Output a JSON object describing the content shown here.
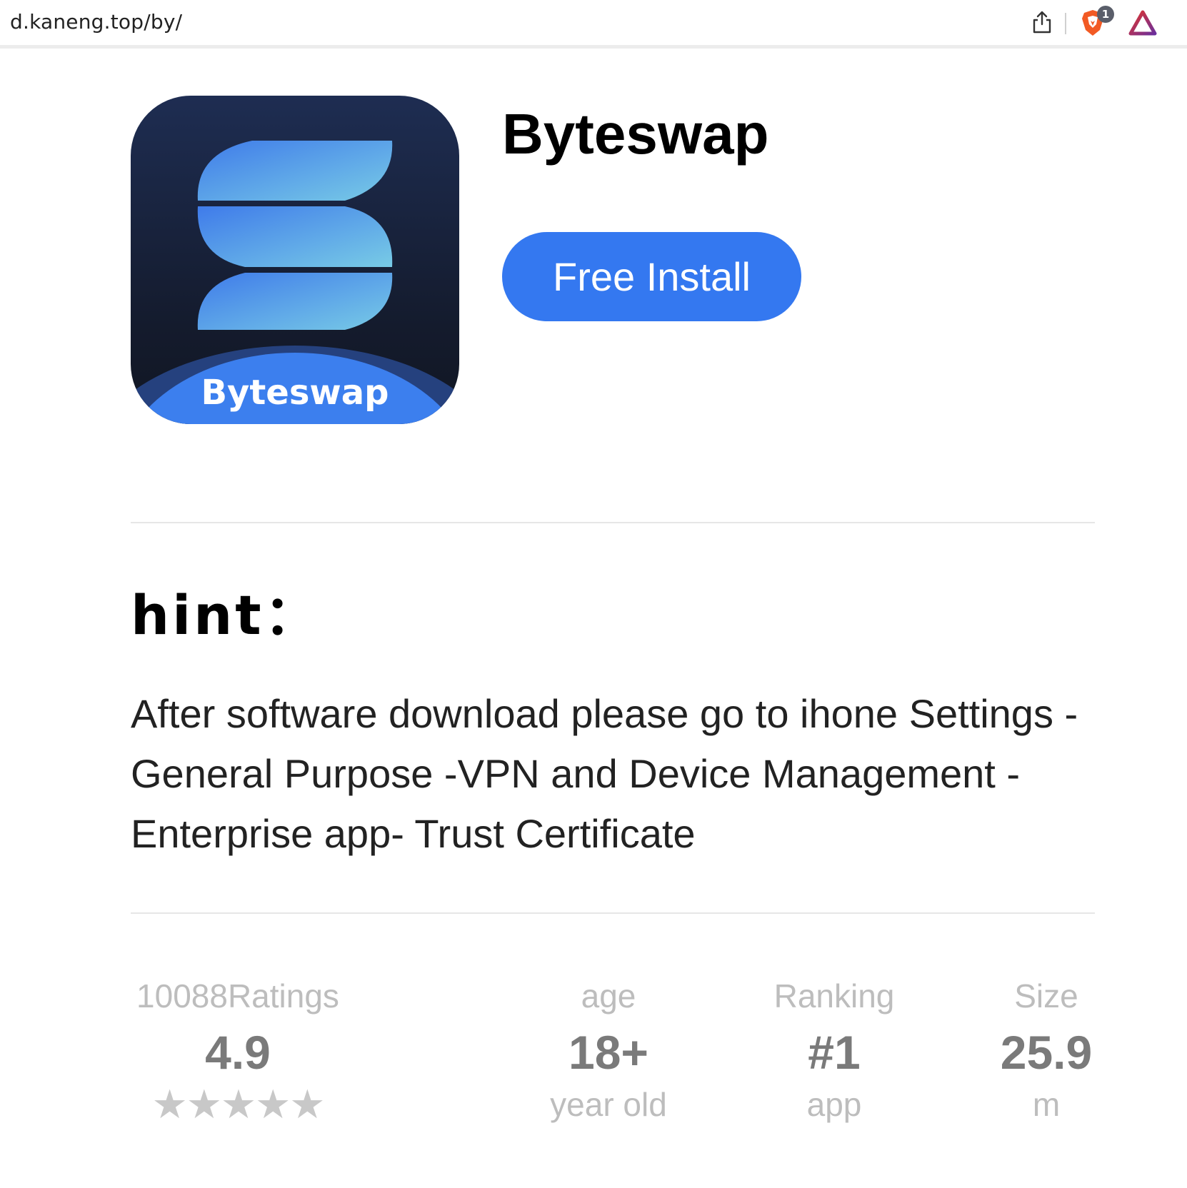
{
  "browser": {
    "url": "d.kaneng.top/by/",
    "shields_badge": "1"
  },
  "app": {
    "name": "Byteswap",
    "icon_label": "Byteswap",
    "install_label": "Free Install",
    "accent_color": "#3478f0"
  },
  "hint": {
    "title": "hint：",
    "text": "After software download please go to ihone Settings - General Purpose -VPN and Device Management - Enterprise app- Trust Certificate"
  },
  "stats": {
    "ratings": {
      "label": "10088Ratings",
      "value": "4.9",
      "stars": "★★★★★"
    },
    "age": {
      "label": "age",
      "value": "18+",
      "sub": "year old"
    },
    "ranking": {
      "label": "Ranking",
      "value": "#1",
      "sub": "app"
    },
    "size": {
      "label": "Size",
      "value": "25.9",
      "sub": "m"
    }
  }
}
